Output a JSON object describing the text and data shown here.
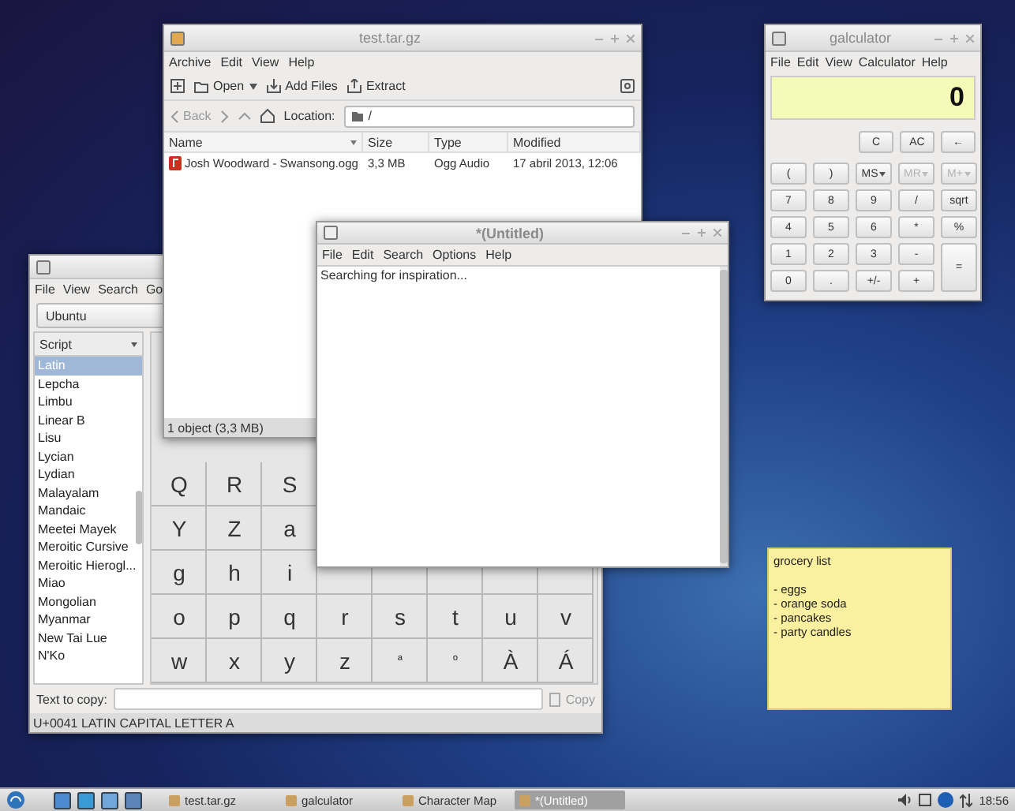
{
  "archive_window": {
    "title": "test.tar.gz",
    "menu": [
      "Archive",
      "Edit",
      "View",
      "Help"
    ],
    "toolbar": {
      "open": "Open",
      "add_files": "Add Files",
      "extract": "Extract"
    },
    "nav": {
      "back": "Back",
      "location_label": "Location:",
      "location": "/"
    },
    "columns": [
      "Name",
      "Size",
      "Type",
      "Modified"
    ],
    "rows": [
      {
        "name": "Josh Woodward - Swansong.ogg",
        "size": "3,3 MB",
        "type": "Ogg Audio",
        "modified": "17 abril 2013, 12:06",
        "selected": false
      }
    ],
    "status": "1 object (3,3 MB)"
  },
  "charmap_window": {
    "menu": [
      "File",
      "View",
      "Search",
      "Go"
    ],
    "font": "Ubuntu",
    "script_header": "Script",
    "scripts": [
      {
        "label": "Latin",
        "selected": true
      },
      {
        "label": "Lepcha",
        "selected": false
      },
      {
        "label": "Limbu",
        "selected": false
      },
      {
        "label": "Linear B",
        "selected": false
      },
      {
        "label": "Lisu",
        "selected": false
      },
      {
        "label": "Lycian",
        "selected": false
      },
      {
        "label": "Lydian",
        "selected": false
      },
      {
        "label": "Malayalam",
        "selected": false
      },
      {
        "label": "Mandaic",
        "selected": false
      },
      {
        "label": "Meetei Mayek",
        "selected": false
      },
      {
        "label": "Meroitic Cursive",
        "selected": false
      },
      {
        "label": "Meroitic Hierogl...",
        "selected": false
      },
      {
        "label": "Miao",
        "selected": false
      },
      {
        "label": "Mongolian",
        "selected": false
      },
      {
        "label": "Myanmar",
        "selected": false
      },
      {
        "label": "New Tai Lue",
        "selected": false
      },
      {
        "label": "N'Ko",
        "selected": false
      }
    ],
    "grid": [
      [
        "Q",
        "R",
        "S"
      ],
      [
        "Y",
        "Z",
        "a"
      ],
      [
        "g",
        "h",
        "i"
      ],
      [
        "o",
        "p",
        "q",
        "r",
        "s",
        "t",
        "u",
        "v"
      ],
      [
        "w",
        "x",
        "y",
        "z",
        "ª",
        "º",
        "À",
        "Á"
      ]
    ],
    "text_to_copy_label": "Text to copy:",
    "copy_button": "Copy",
    "status": "U+0041 LATIN CAPITAL LETTER A"
  },
  "editor_window": {
    "title": "*(Untitled)",
    "menu": [
      "File",
      "Edit",
      "Search",
      "Options",
      "Help"
    ],
    "text": "Searching for inspiration..."
  },
  "calculator_window": {
    "title": "galculator",
    "menu": [
      "File",
      "Edit",
      "View",
      "Calculator",
      "Help"
    ],
    "display": "0",
    "top_buttons": [
      {
        "label": "C",
        "disabled": false
      },
      {
        "label": "AC",
        "disabled": false
      },
      {
        "label": "←",
        "disabled": false
      }
    ],
    "keypad": [
      {
        "label": "(",
        "kind": "key",
        "disabled": false
      },
      {
        "label": ")",
        "kind": "key",
        "disabled": false
      },
      {
        "label": "MS",
        "kind": "memory",
        "disabled": false
      },
      {
        "label": "MR",
        "kind": "memory",
        "disabled": true
      },
      {
        "label": "M+",
        "kind": "memory",
        "disabled": true
      },
      {
        "label": "7",
        "kind": "key",
        "disabled": false
      },
      {
        "label": "8",
        "kind": "key",
        "disabled": false
      },
      {
        "label": "9",
        "kind": "key",
        "disabled": false
      },
      {
        "label": "/",
        "kind": "key",
        "disabled": false
      },
      {
        "label": "sqrt",
        "kind": "key",
        "disabled": false
      },
      {
        "label": "4",
        "kind": "key",
        "disabled": false
      },
      {
        "label": "5",
        "kind": "key",
        "disabled": false
      },
      {
        "label": "6",
        "kind": "key",
        "disabled": false
      },
      {
        "label": "*",
        "kind": "key",
        "disabled": false
      },
      {
        "label": "%",
        "kind": "key",
        "disabled": false
      },
      {
        "label": "1",
        "kind": "key",
        "disabled": false
      },
      {
        "label": "2",
        "kind": "key",
        "disabled": false
      },
      {
        "label": "3",
        "kind": "key",
        "disabled": false
      },
      {
        "label": "-",
        "kind": "key",
        "disabled": false
      },
      {
        "label": "=",
        "kind": "tall",
        "disabled": false
      },
      {
        "label": "0",
        "kind": "key",
        "disabled": false
      },
      {
        "label": ".",
        "kind": "key",
        "disabled": false
      },
      {
        "label": "+/-",
        "kind": "key",
        "disabled": false
      },
      {
        "label": "+",
        "kind": "key",
        "disabled": false
      }
    ]
  },
  "sticky_note": {
    "title": "grocery list",
    "items": [
      "- eggs",
      "- orange soda",
      "- pancakes",
      "- party candles"
    ]
  },
  "taskbar": {
    "tasks": [
      {
        "label": "test.tar.gz",
        "selected": false
      },
      {
        "label": "galculator",
        "selected": false
      },
      {
        "label": "Character Map",
        "selected": false
      },
      {
        "label": "*(Untitled)",
        "selected": true
      }
    ],
    "clock": "18:56"
  }
}
